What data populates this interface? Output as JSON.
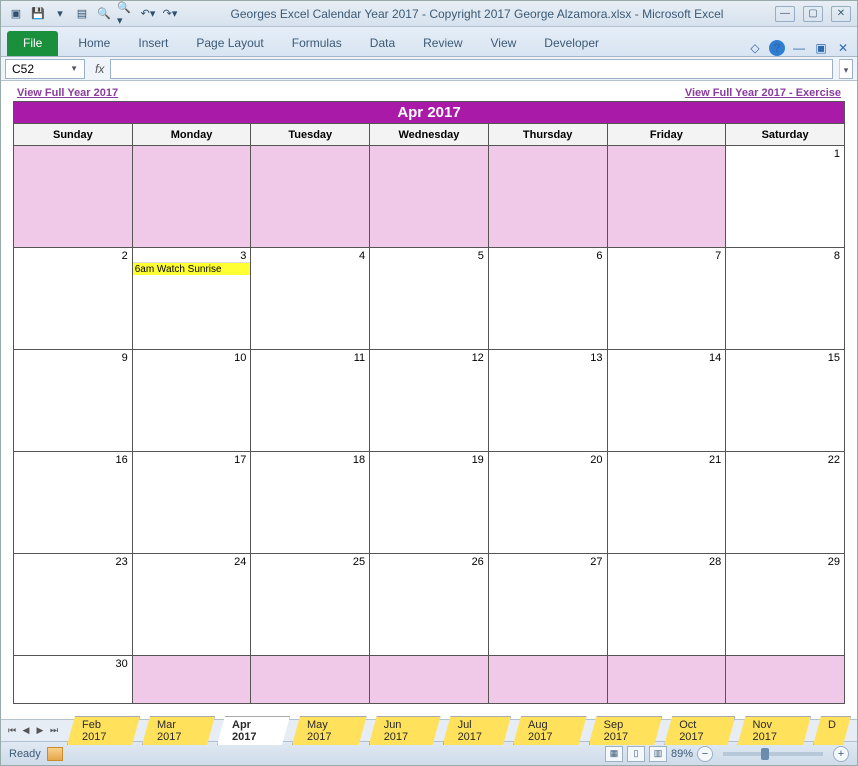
{
  "title": "Georges Excel Calendar Year 2017  -  Copyright 2017 George Alzamora.xlsx  -  Microsoft Excel",
  "ribbon": {
    "file": "File",
    "tabs": [
      "Home",
      "Insert",
      "Page Layout",
      "Formulas",
      "Data",
      "Review",
      "View",
      "Developer"
    ]
  },
  "namebox": "C52",
  "fx_label": "fx",
  "links": {
    "left": "View Full Year 2017",
    "right": "View Full Year 2017 - Exercise"
  },
  "month_title": "Apr 2017",
  "dow": [
    "Sunday",
    "Monday",
    "Tuesday",
    "Wednesday",
    "Thursday",
    "Friday",
    "Saturday"
  ],
  "weeks": [
    [
      {
        "n": "",
        "pad": true
      },
      {
        "n": "",
        "pad": true
      },
      {
        "n": "",
        "pad": true
      },
      {
        "n": "",
        "pad": true
      },
      {
        "n": "",
        "pad": true
      },
      {
        "n": "",
        "pad": true
      },
      {
        "n": "1"
      }
    ],
    [
      {
        "n": "2"
      },
      {
        "n": "3",
        "ev": "6am Watch Sunrise"
      },
      {
        "n": "4"
      },
      {
        "n": "5"
      },
      {
        "n": "6"
      },
      {
        "n": "7"
      },
      {
        "n": "8"
      }
    ],
    [
      {
        "n": "9"
      },
      {
        "n": "10"
      },
      {
        "n": "11"
      },
      {
        "n": "12"
      },
      {
        "n": "13"
      },
      {
        "n": "14"
      },
      {
        "n": "15"
      }
    ],
    [
      {
        "n": "16"
      },
      {
        "n": "17"
      },
      {
        "n": "18"
      },
      {
        "n": "19"
      },
      {
        "n": "20"
      },
      {
        "n": "21"
      },
      {
        "n": "22"
      }
    ],
    [
      {
        "n": "23"
      },
      {
        "n": "24"
      },
      {
        "n": "25"
      },
      {
        "n": "26"
      },
      {
        "n": "27"
      },
      {
        "n": "28"
      },
      {
        "n": "29"
      }
    ],
    [
      {
        "n": "30"
      },
      {
        "n": "",
        "pad": true
      },
      {
        "n": "",
        "pad": true
      },
      {
        "n": "",
        "pad": true
      },
      {
        "n": "",
        "pad": true
      },
      {
        "n": "",
        "pad": true
      },
      {
        "n": "",
        "pad": true
      }
    ]
  ],
  "sheet_tabs": [
    "Feb 2017",
    "Mar 2017",
    "Apr 2017",
    "May 2017",
    "Jun 2017",
    "Jul 2017",
    "Aug 2017",
    "Sep 2017",
    "Oct 2017",
    "Nov 2017",
    "D"
  ],
  "active_sheet": "Apr 2017",
  "status": {
    "ready": "Ready",
    "zoom": "89%"
  }
}
